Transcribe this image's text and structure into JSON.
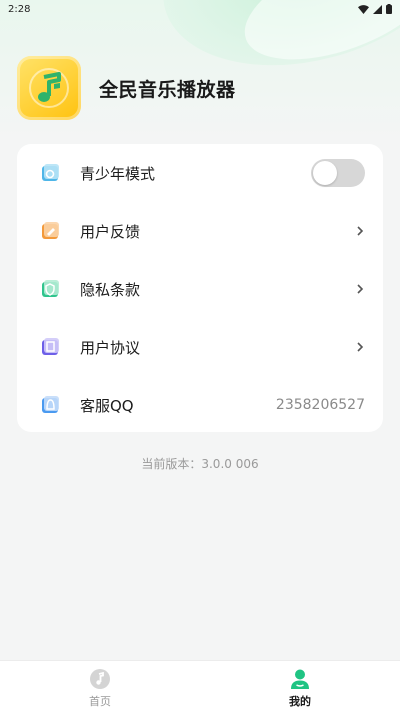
{
  "status_bar": {
    "time": "2:28"
  },
  "app": {
    "name": "全民音乐播放器"
  },
  "settings": {
    "teen_mode": {
      "label": "青少年模式",
      "enabled": false
    },
    "feedback": {
      "label": "用户反馈"
    },
    "privacy": {
      "label": "隐私条款"
    },
    "agreement": {
      "label": "用户协议"
    },
    "service_qq": {
      "label": "客服QQ",
      "value": "2358206527"
    }
  },
  "version": {
    "text": "当前版本：3.0.0 006"
  },
  "tabs": [
    {
      "label": "首页",
      "icon": "music-disc-icon",
      "active": false
    },
    {
      "label": "我的",
      "icon": "person-icon",
      "active": true
    }
  ],
  "colors": {
    "accent": "#1fc483",
    "logo_yellow": "#ffc20e",
    "teen_icon": "#4fb6e8",
    "feedback_icon": "#f39a3b",
    "privacy_icon": "#2fc48d",
    "agreement_icon": "#6d5fe8",
    "qq_icon": "#4a9af0"
  }
}
